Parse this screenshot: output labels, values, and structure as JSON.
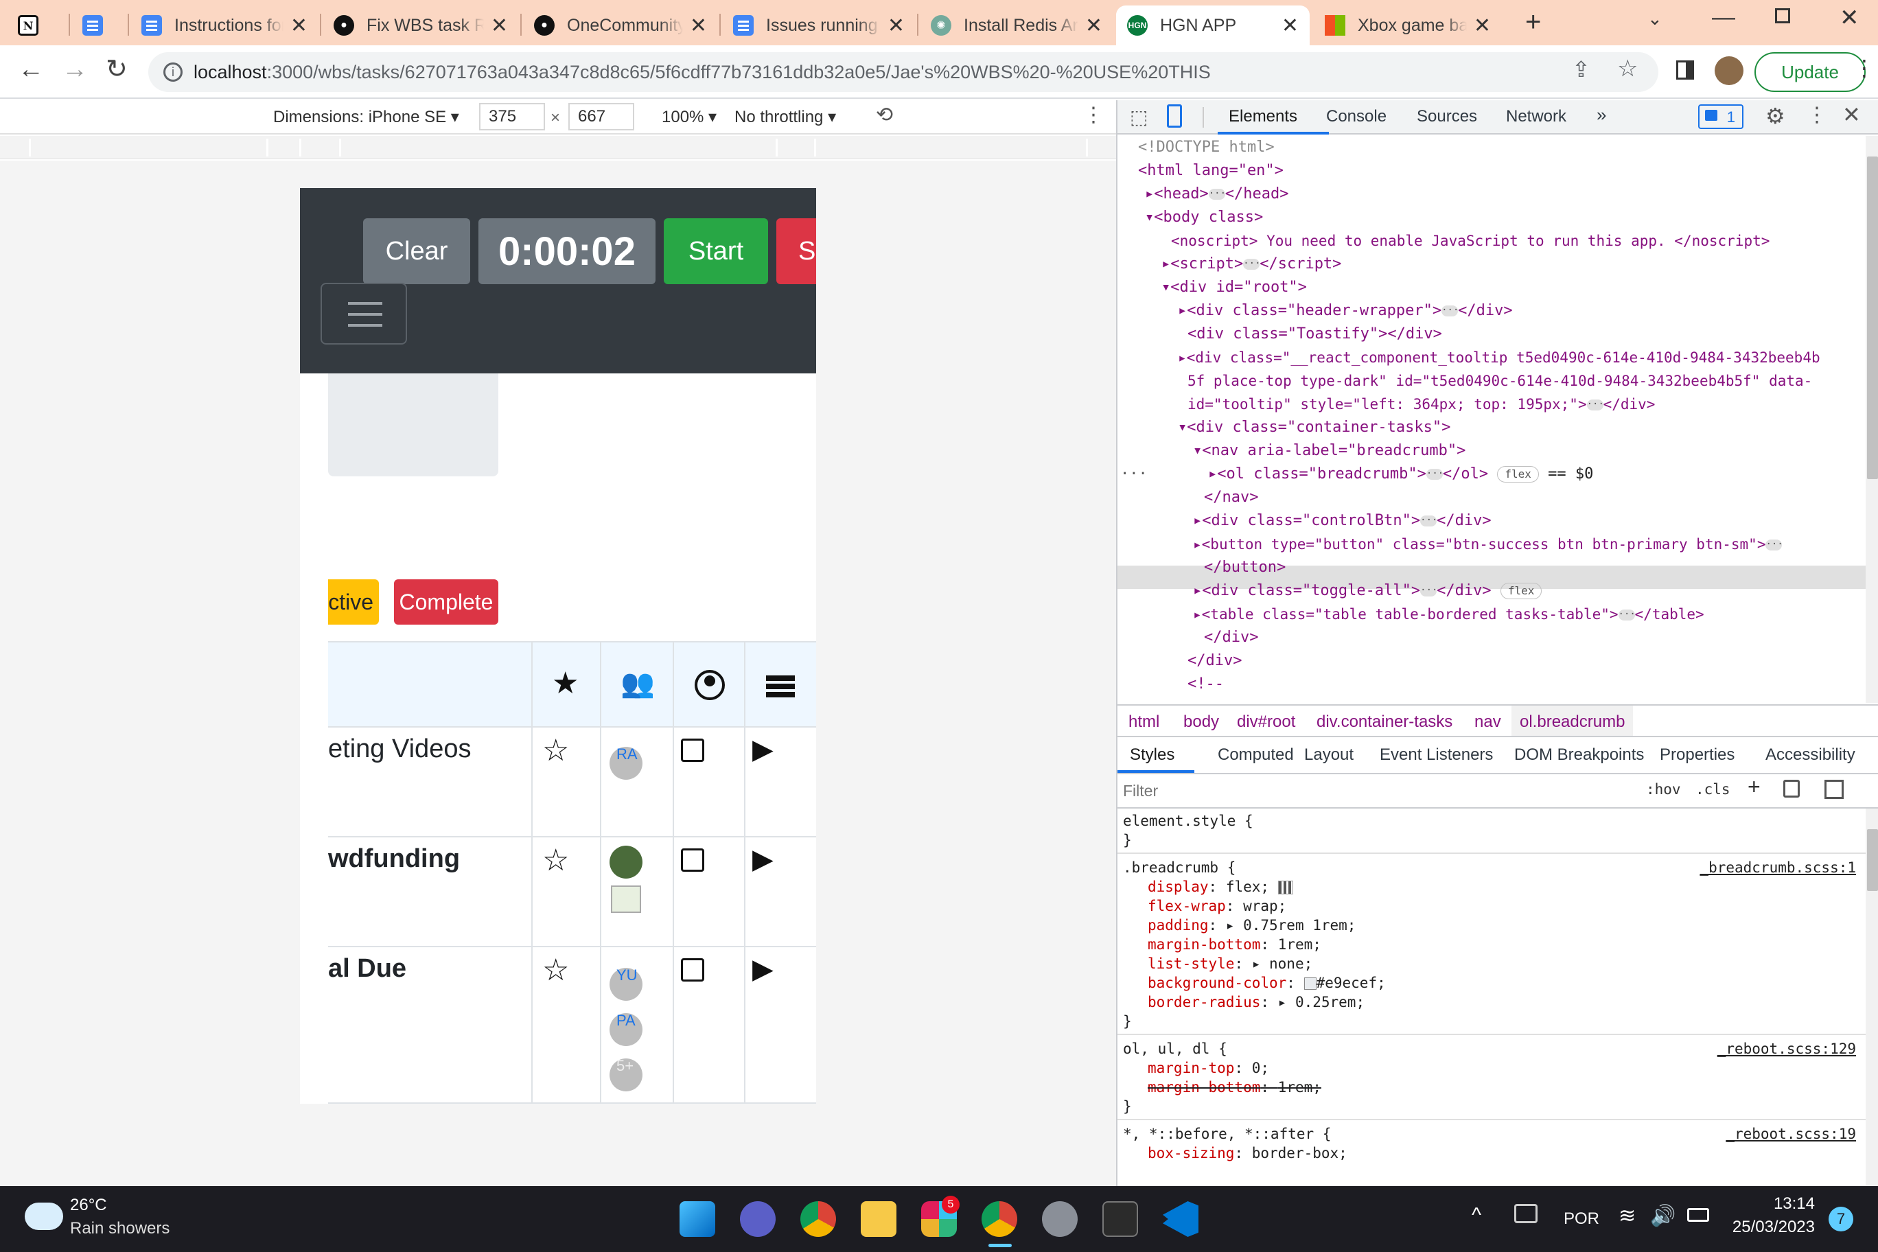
{
  "browser": {
    "tabs": [
      {
        "title": "",
        "icon": "notion-icon"
      },
      {
        "title": "",
        "icon": "google-docs-icon"
      },
      {
        "title": "Instructions for",
        "icon": "google-docs-icon"
      },
      {
        "title": "Fix WBS task Re",
        "icon": "github-icon"
      },
      {
        "title": "OneCommunity",
        "icon": "github-icon"
      },
      {
        "title": "Issues running",
        "icon": "google-docs-icon"
      },
      {
        "title": "Install Redis Ar",
        "icon": "chatgpt-icon"
      },
      {
        "title": "HGN APP",
        "icon": "hgn-icon",
        "active": true
      },
      {
        "title": "Xbox game bar",
        "icon": "microsoft-icon"
      }
    ],
    "url_host": "localhost",
    "url_path": ":3000/wbs/tasks/627071763a043a347c8d8c65/5f6cdff77b73161ddb32a0e5/Jae's%20WBS%20-%20USE%20THIS",
    "update_label": "Update"
  },
  "device_toolbar": {
    "dimensions_label": "Dimensions: iPhone SE",
    "width": "375",
    "times": "×",
    "height": "667",
    "zoom": "100%",
    "throttling": "No throttling"
  },
  "app": {
    "clear_label": "Clear",
    "timer": "0:00:02",
    "start_label": "Start",
    "stop_label_partial": "S",
    "filter_active_partial": "ctive",
    "filter_complete": "Complete",
    "rows": [
      {
        "name": "eting Videos",
        "bold": false,
        "avatars": [
          "RA"
        ]
      },
      {
        "name": "wdfunding",
        "bold": true,
        "avatars": [
          "photo",
          "broken-image"
        ]
      },
      {
        "name": "al Due",
        "bold": true,
        "avatars": [
          "YU",
          "PA",
          "5+"
        ]
      }
    ]
  },
  "devtools": {
    "tabs": [
      "Elements",
      "Console",
      "Sources",
      "Network"
    ],
    "more": "»",
    "issues_count": "1",
    "dom_lines": [
      "<!DOCTYPE html>",
      "<html lang=\"en\">",
      "<head>",
      "<body class>",
      "<noscript> You need to enable JavaScript to run this app. </noscript>",
      "<script>",
      "<div id=\"root\">",
      "<div class=\"header-wrapper\">",
      "<div class=\"Toastify\"></div>",
      "<div class=\"__react_component_tooltip t5ed0490c-614e-410d-9484-3432beeb4b",
      "5f place-top type-dark\" id=\"t5ed0490c-614e-410d-9484-3432beeb4b5f\" data-",
      "id=\"tooltip\" style=\"left: 364px; top: 195px;\">",
      "<div class=\"container-tasks\">",
      "<nav aria-label=\"breadcrumb\">",
      "<ol class=\"breadcrumb\">",
      "</nav>",
      "<div class=\"controlBtn\">",
      "<button type=\"button\" class=\"btn-success btn btn-primary btn-sm\">",
      "</button>",
      "<div class=\"toggle-all\">",
      "<table class=\"table table-bordered tasks-table\">",
      "</div>",
      "</div>",
      "<!--"
    ],
    "selected_suffix": "== $0",
    "flex_badge": "flex",
    "breadcrumbs": [
      "html",
      "body",
      "div#root",
      "div.container-tasks",
      "nav",
      "ol.breadcrumb"
    ],
    "sub_tabs": [
      "Styles",
      "Computed",
      "Layout",
      "Event Listeners",
      "DOM Breakpoints",
      "Properties",
      "Accessibility"
    ],
    "filter_placeholder": "Filter",
    "hov": ":hov",
    "cls": ".cls",
    "styles": {
      "element_style": "element.style {",
      "rule1_selector": ".breadcrumb {",
      "rule1_source": "_breadcrumb.scss:1",
      "rule1_props": [
        [
          "display",
          "flex;"
        ],
        [
          "flex-wrap",
          "wrap;"
        ],
        [
          "padding",
          "0.75rem 1rem;"
        ],
        [
          "margin-bottom",
          "1rem;"
        ],
        [
          "list-style",
          "none;"
        ],
        [
          "background-color",
          "#e9ecef;"
        ],
        [
          "border-radius",
          "0.25rem;"
        ]
      ],
      "rule2_selector": "ol, ul, dl {",
      "rule2_source": "_reboot.scss:129",
      "rule2_props": [
        [
          "margin-top",
          "0;"
        ],
        [
          "margin-bottom",
          "1rem;"
        ]
      ],
      "rule3_selector": "*, *::before, *::after {",
      "rule3_source": "_reboot.scss:19",
      "rule3_props": [
        [
          "box-sizing",
          "border-box;"
        ]
      ],
      "close": "}"
    }
  },
  "taskbar": {
    "temperature": "26°C",
    "weather": "Rain showers",
    "language": "POR",
    "time": "13:14",
    "date": "25/03/2023",
    "notifications": "7",
    "slack_badge": "5"
  },
  "colors": {
    "tabstrip": "#fbd7c3",
    "app_header": "#343a40",
    "clear_btn": "#6c757d",
    "start_btn": "#28a745",
    "stop_btn": "#dc3545",
    "active_filter": "#ffc107"
  }
}
